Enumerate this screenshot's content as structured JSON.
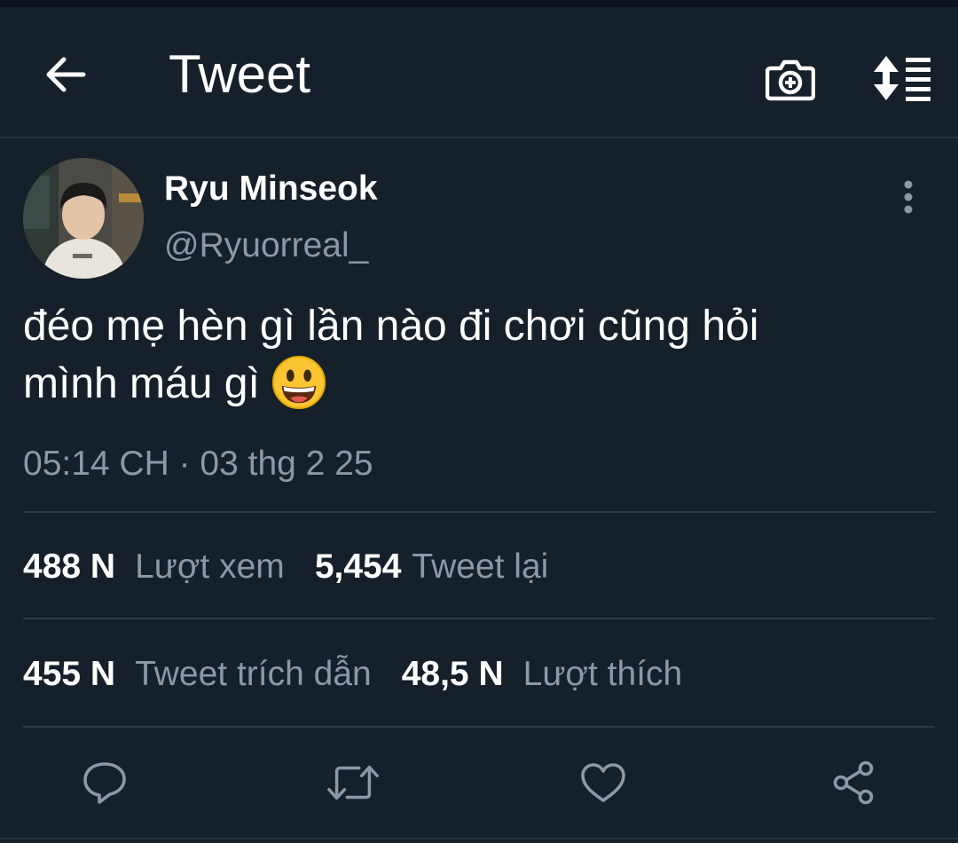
{
  "appbar": {
    "title": "Tweet",
    "back_icon": "arrow-left-icon",
    "camera_icon": "camera-plus-icon",
    "sort_icon": "sort-list-icon"
  },
  "tweet": {
    "author": {
      "display_name": "Ryu Minseok",
      "handle": "@Ryuorreal_"
    },
    "text_line1": "đéo mẹ hèn gì lần nào đi chơi cũng hỏi",
    "text_line2": "mình máu gì",
    "emoji": "grinning-face-emoji",
    "timestamp": "05:14 CH · 03 thg 2 25"
  },
  "stats": {
    "views_count": "488 N",
    "views_label": "Lượt xem",
    "retweets_count": "5,454",
    "retweets_label": "Tweet lại",
    "quotes_count": "455 N",
    "quotes_label": "Tweet trích dẫn",
    "likes_count": "48,5 N",
    "likes_label": "Lượt thích"
  },
  "actions": [
    "reply-icon",
    "retweet-icon",
    "like-icon",
    "share-icon"
  ],
  "colors": {
    "background": "#15202b",
    "primary_text": "#ffffff",
    "secondary_text": "#8b98a5",
    "icon": "#8b98a5",
    "divider": "#2f3b47"
  }
}
